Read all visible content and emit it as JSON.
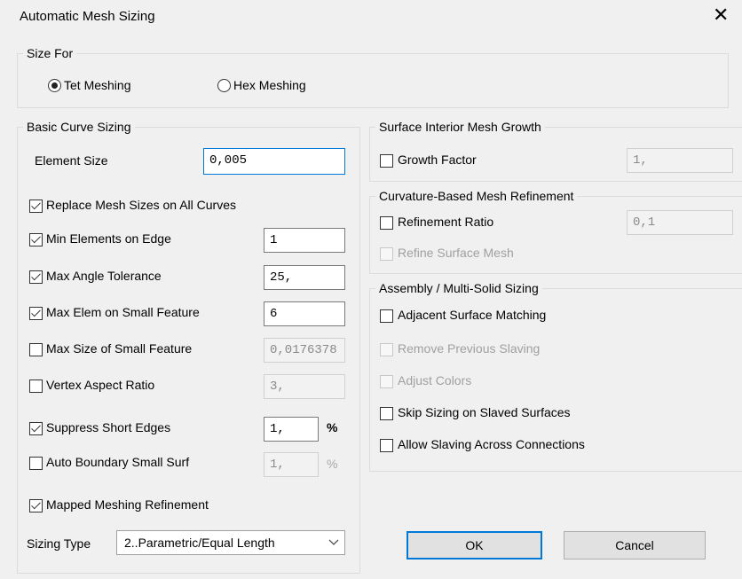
{
  "window": {
    "title": "Automatic Mesh Sizing",
    "close_glyph": "✕"
  },
  "size_for": {
    "label": "Size For",
    "tet": "Tet Meshing",
    "hex": "Hex Meshing",
    "selected": "tet"
  },
  "basic": {
    "label": "Basic Curve Sizing",
    "element_size_label": "Element Size",
    "element_size_value": "0,005",
    "replace_label": "Replace Mesh Sizes on All Curves",
    "min_elements_label": "Min Elements on Edge",
    "min_elements_value": "1",
    "max_angle_label": "Max Angle Tolerance",
    "max_angle_value": "25,",
    "max_elem_small_label": "Max Elem on Small Feature",
    "max_elem_small_value": "6",
    "max_size_small_label": "Max Size of Small Feature",
    "max_size_small_value": "0,0176378",
    "vertex_aspect_label": "Vertex Aspect Ratio",
    "vertex_aspect_value": "3,",
    "suppress_label": "Suppress Short Edges",
    "suppress_value": "1,",
    "suppress_unit": "%",
    "auto_boundary_label": "Auto Boundary Small Surf",
    "auto_boundary_value": "1,",
    "auto_boundary_unit": "%",
    "mapped_label": "Mapped Meshing Refinement",
    "sizing_type_label": "Sizing Type",
    "sizing_type_value": "2..Parametric/Equal Length"
  },
  "growth": {
    "label": "Surface Interior Mesh Growth",
    "factor_label": "Growth  Factor",
    "factor_value": "1,"
  },
  "curvature": {
    "label": "Curvature-Based Mesh Refinement",
    "ratio_label": "Refinement Ratio",
    "ratio_value": "0,1",
    "refine_surface_label": "Refine Surface Mesh"
  },
  "assembly": {
    "label": "Assembly / Multi-Solid Sizing",
    "adjacent_label": "Adjacent Surface Matching",
    "remove_label": "Remove Previous Slaving",
    "adjust_label": "Adjust Colors",
    "skip_label": "Skip Sizing on Slaved Surfaces",
    "allow_label": "Allow Slaving Across Connections"
  },
  "buttons": {
    "ok": "OK",
    "cancel": "Cancel"
  },
  "icons": {
    "close": "close-icon",
    "dropdown": "chevron-down-icon"
  },
  "colors": {
    "focus_border": "#0078d7",
    "background": "#f0f0f0"
  }
}
